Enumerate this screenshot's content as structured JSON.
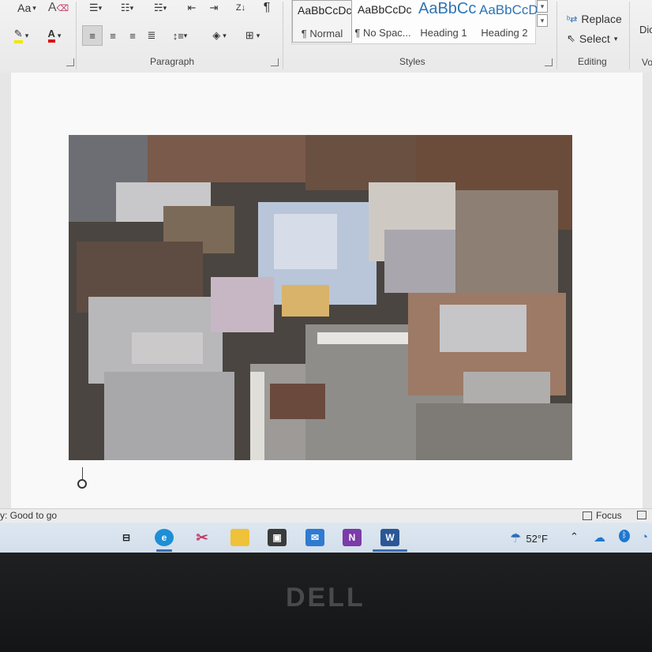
{
  "ribbon": {
    "font_group": {
      "change_case_label": "Aa"
    },
    "paragraph_label": "Paragraph",
    "styles_label": "Styles",
    "editing_label": "Editing",
    "cut_off_right_top": "Dic",
    "cut_off_right_bottom": "Vo",
    "styles": [
      {
        "sample": "AaBbCcDc",
        "name": "¶ Normal",
        "active": true
      },
      {
        "sample": "AaBbCcDc",
        "name": "¶ No Spac...",
        "active": false
      },
      {
        "sample": "AaBbCc",
        "name": "Heading 1",
        "active": false
      },
      {
        "sample": "AaBbCcD",
        "name": "Heading 2",
        "active": false
      }
    ],
    "editing": {
      "replace_label": "Replace",
      "select_label": "Select"
    }
  },
  "statusbar": {
    "accessibility_text": "y: Good to go",
    "focus_label": "Focus"
  },
  "taskbar": {
    "weather_temp": "52°F",
    "apps": [
      "task-view",
      "edge",
      "snip",
      "file-explorer",
      "store",
      "mail",
      "onenote",
      "word"
    ]
  },
  "bezel": {
    "brand": "DELL"
  },
  "colors": {
    "ribbon_bg": "#f2f2f2",
    "heading_blue": "#2e74b5",
    "taskbar_bg": "#d3dfeb"
  }
}
